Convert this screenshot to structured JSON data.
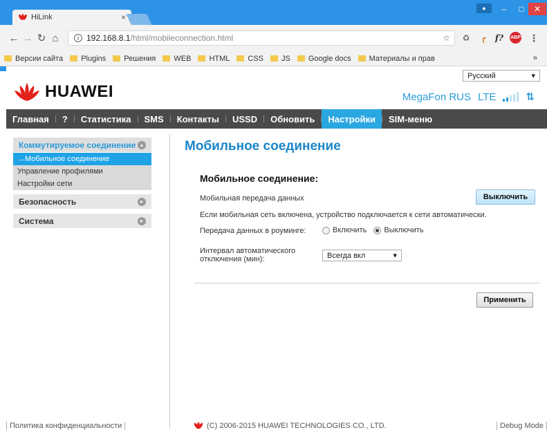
{
  "browser": {
    "tab_title": "HiLink",
    "tab_close": "×",
    "url_host": "192.168.8.1",
    "url_path": "/html/mobileconnection.html",
    "bookmarks": [
      "Версии сайта",
      "Plugins",
      "Решения",
      "WEB",
      "HTML",
      "CSS",
      "JS",
      "Google docs",
      "Материалы и прав"
    ],
    "bookmarks_more": "»"
  },
  "header": {
    "logo_text": "HUAWEI",
    "language": "Русский",
    "operator": "MegaFon RUS",
    "network_type": "LTE",
    "signal_bars_lit": 2,
    "signal_bars_total": 5
  },
  "nav": {
    "items": [
      "Главная",
      "?",
      "Статистика",
      "SMS",
      "Контакты",
      "USSD",
      "Обновить",
      "Настройки",
      "SIM-меню"
    ],
    "active": "Настройки"
  },
  "sidebar": {
    "dialup": "Коммутируемое соединение",
    "dialup_items": [
      "→Мобильное соединение",
      "Управление профилями",
      "Настройки сети"
    ],
    "security": "Безопасность",
    "system": "Система"
  },
  "content": {
    "title": "Мобильное соединение",
    "subtitle": "Мобильное соединение:",
    "mobile_data_label": "Мобильная передача данных",
    "off_button": "Выключить",
    "info_text": "Если мобильная сеть включена, устройство подключается к сети автоматически.",
    "roaming_label": "Передача данных в роуминге:",
    "roaming_on": "Включить",
    "roaming_off": "Выключить",
    "roaming_selected": "Выключить",
    "interval_label_1": "Интервал автоматического",
    "interval_label_2": "отключения (мин):",
    "interval_value": "Всегда вкл",
    "apply_button": "Применить"
  },
  "footer": {
    "privacy": "Политика конфиденциальности",
    "copyright": "(C) 2006-2015 HUAWEI TECHNOLOGIES CO., LTD.",
    "debug": "Debug Mode"
  },
  "colors": {
    "chrome": "#2c93e6",
    "accent": "#2aa7e0",
    "huawei_red": "#e3211c"
  }
}
